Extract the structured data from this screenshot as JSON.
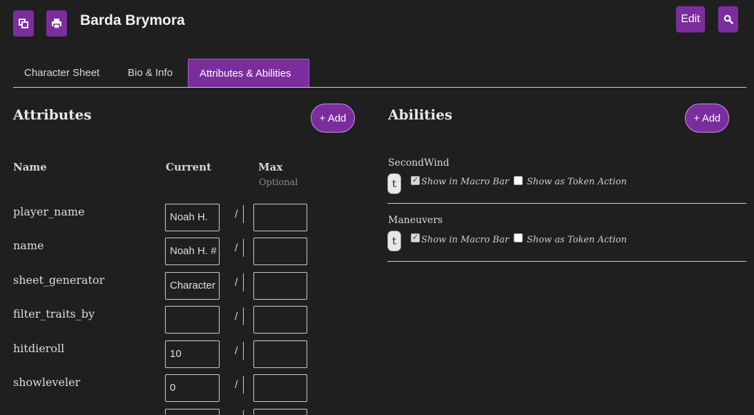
{
  "header": {
    "title": "Barda Brymora",
    "edit_label": "Edit"
  },
  "tabs": [
    {
      "label": "Character Sheet"
    },
    {
      "label": "Bio & Info"
    },
    {
      "label": "Attributes & Abilities"
    }
  ],
  "attributes": {
    "heading": "Attributes",
    "add_label": "+ Add",
    "col_name": "Name",
    "col_current": "Current",
    "col_max": "Max",
    "col_max_hint": "Optional",
    "rows": [
      {
        "name": "player_name",
        "current": "Noah H.",
        "max": ""
      },
      {
        "name": "name",
        "current": "Noah H. #",
        "max": ""
      },
      {
        "name": "sheet_generator",
        "current": "Character",
        "max": ""
      },
      {
        "name": "filter_traits_by",
        "current": "",
        "max": ""
      },
      {
        "name": "hitdieroll",
        "current": "10",
        "max": ""
      },
      {
        "name": "showleveler",
        "current": "0",
        "max": ""
      }
    ],
    "separator": "/"
  },
  "abilities": {
    "heading": "Abilities",
    "add_label": "+ Add",
    "items": [
      {
        "name": "SecondWind",
        "token_label": "t",
        "macro_bar_label": "Show in Macro Bar",
        "macro_bar_checked": true,
        "token_action_label": "Show as Token Action",
        "token_action_checked": false
      },
      {
        "name": "Maneuvers",
        "token_label": "t",
        "macro_bar_label": "Show in Macro Bar",
        "macro_bar_checked": true,
        "token_action_label": "Show as Token Action",
        "token_action_checked": false
      }
    ]
  },
  "icons": {
    "popout": "popout-icon",
    "print": "print-icon",
    "search": "search-icon"
  },
  "colors": {
    "accent": "#7b2d9e",
    "background": "#1f1f1f"
  }
}
